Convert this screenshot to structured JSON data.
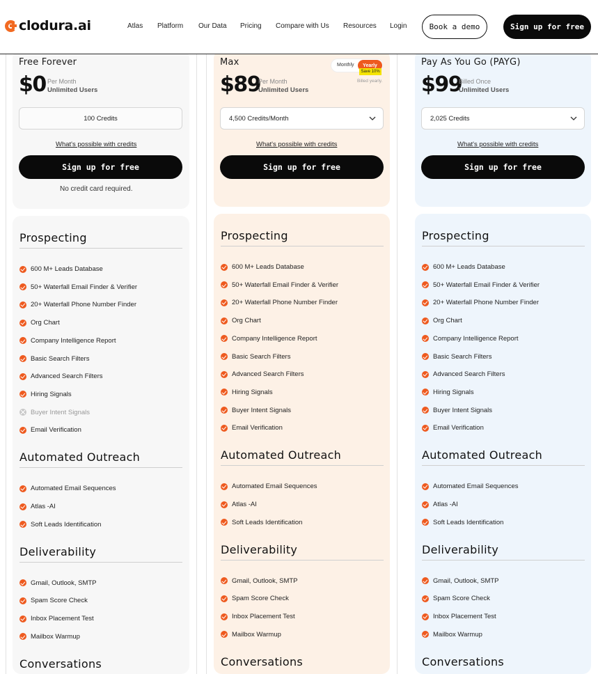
{
  "brand": {
    "name": "clodura.ai",
    "accent": "#ee5a1f"
  },
  "nav": {
    "items": [
      "Atlas",
      "Platform",
      "Our Data",
      "Pricing",
      "Compare with Us",
      "Resources",
      "Login"
    ],
    "book_demo": "Book a demo",
    "signup": "Sign up for free"
  },
  "billing_toggle": {
    "monthly": "Monthly",
    "yearly": "Yearly",
    "save": "Save 10%",
    "note": "Billed yearly."
  },
  "plans": [
    {
      "name": "Free Forever",
      "price": "$0",
      "period": "Per Month",
      "users": "Unlimited Users",
      "credits": "100 Credits",
      "credits_link": "What's possible with credits",
      "cta": "Sign up for free",
      "note": "No credit card required.",
      "bg": "#f7f7f7"
    },
    {
      "name": "Max",
      "price": "$89",
      "period": "Per Month",
      "users": "Unlimited Users",
      "credits": "4,500 Credits/Month",
      "credits_link": "What's possible with credits",
      "cta": "Sign up for free",
      "bg": "#fdf1e6"
    },
    {
      "name": "Pay As You Go (PAYG)",
      "price": "$99",
      "period": "Billed Once",
      "users": "Unlimited Users",
      "credits": "2,025 Credits",
      "credits_link": "What's possible with credits",
      "cta": "Sign up for free",
      "bg": "#eef5fc"
    }
  ],
  "sections": [
    {
      "title": "Prospecting",
      "features": [
        "600 M+ Leads Database",
        "50+ Waterfall Email Finder & Verifier",
        "20+ Waterfall Phone Number Finder",
        "Org Chart",
        "Company Intelligence Report",
        "Basic Search Filters",
        "Advanced Search Filters",
        "Hiring Signals",
        "Buyer Intent Signals",
        "Email Verification"
      ]
    },
    {
      "title": "Automated Outreach",
      "features": [
        "Automated Email Sequences",
        "Atlas -AI",
        "Soft Leads Identification"
      ]
    },
    {
      "title": "Deliverability",
      "features": [
        "Gmail, Outlook, SMTP",
        "Spam Score Check",
        "Inbox Placement Test",
        "Mailbox Warmup"
      ]
    },
    {
      "title": "Conversations"
    }
  ],
  "free_plan_unavailable": [
    "Buyer Intent Signals"
  ]
}
